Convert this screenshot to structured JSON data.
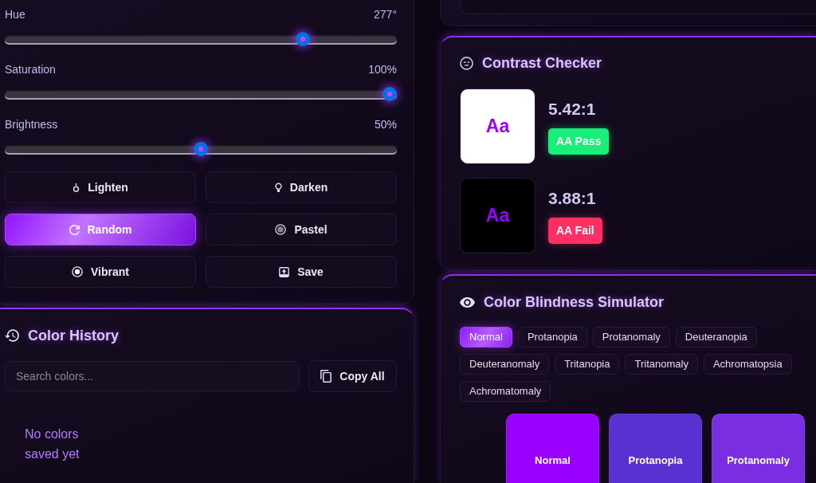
{
  "color_controls": {
    "sliders": [
      {
        "label": "Hue",
        "value": "277°",
        "level": 0.77
      },
      {
        "label": "Saturation",
        "value": "100%",
        "level": 1
      },
      {
        "label": "Brightness",
        "value": "50%",
        "level": 0.5
      }
    ],
    "buttons": [
      {
        "label": "Lighten",
        "kind": "lighten",
        "active": false
      },
      {
        "label": "Darken",
        "kind": "darken",
        "active": false
      },
      {
        "label": "Random",
        "kind": "random",
        "active": true
      },
      {
        "label": "Pastel",
        "kind": "pastel",
        "active": false
      },
      {
        "label": "Vibrant",
        "kind": "vibrant",
        "active": false
      },
      {
        "label": "Save",
        "kind": "save",
        "active": false
      }
    ]
  },
  "color_history": {
    "title": "Color History",
    "search": {
      "placeholder": "Search colors..."
    },
    "copy_button": "Copy All",
    "empty_message": "No colors saved yet"
  },
  "contrast_checker": {
    "title": "Contrast Checker",
    "samples": [
      {
        "text": "Aa",
        "color": "#ffffff",
        "ratio": "5.42:1",
        "badge": "AA Pass",
        "pass": true
      },
      {
        "text": "Aa",
        "color": "#000000",
        "ratio": "3.88:1",
        "badge": "AA Fail",
        "pass": false
      }
    ]
  },
  "color_blindness_simulator": {
    "title": "Color Blindness Simulator",
    "modes": [
      {
        "label": "Normal",
        "selected": true
      },
      {
        "label": "Protanopia",
        "selected": false
      },
      {
        "label": "Protanomaly",
        "selected": false
      },
      {
        "label": "Deuteranopia",
        "selected": false
      },
      {
        "label": "Deuteranomaly",
        "selected": false
      },
      {
        "label": "Tritanopia",
        "selected": false
      },
      {
        "label": "Tritanomaly",
        "selected": false
      },
      {
        "label": "Achromatopsia",
        "selected": false
      },
      {
        "label": "Achromatomaly",
        "selected": false
      }
    ],
    "swatches": [
      {
        "label": "Normal",
        "color": "#9a00ff"
      },
      {
        "label": "Protanopia",
        "color": "#5b30d0"
      },
      {
        "label": "Protanomaly",
        "color": "#7a2ee2"
      }
    ]
  }
}
